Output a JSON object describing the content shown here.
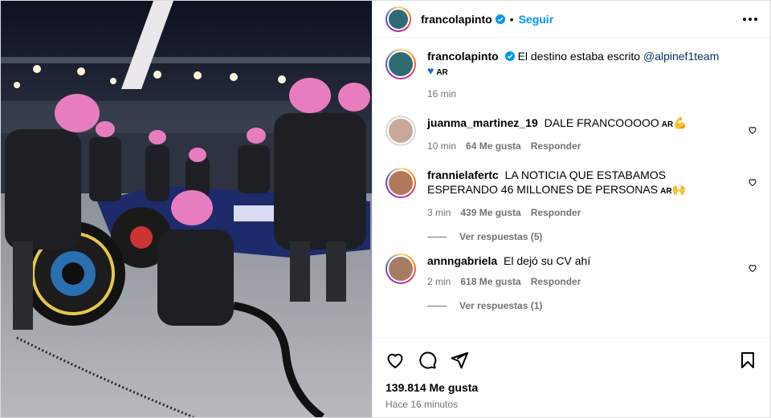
{
  "header": {
    "username": "francolapinto",
    "separator": "•",
    "follow_label": "Seguir"
  },
  "caption": {
    "username": "francolapinto",
    "text": "El destino estaba escrito",
    "mention": "@alpinef1team",
    "tag": "AR",
    "time": "16 min"
  },
  "comments": [
    {
      "username": "juanma_martinez_19",
      "text": "DALE FRANCOOOOO",
      "tag": "AR",
      "emoji": "💪",
      "time": "10 min",
      "likes": "64 Me gusta",
      "reply": "Responder"
    },
    {
      "username": "frannielafertc",
      "text": "LA NOTICIA QUE ESTABAMOS ESPERANDO 46 MILLONES DE PERSONAS",
      "tag": "AR",
      "emoji": "🙌",
      "time": "3 min",
      "likes": "439 Me gusta",
      "reply": "Responder",
      "view_replies": "Ver respuestas (5)"
    },
    {
      "username": "annngabriela",
      "text": "El dejó su CV ahí",
      "tag": "",
      "emoji": "",
      "time": "2 min",
      "likes": "618 Me gusta",
      "reply": "Responder",
      "view_replies": "Ver respuestas (1)"
    }
  ],
  "footer": {
    "likes": "139.814 Me gusta",
    "time": "Hace 16 minutos"
  },
  "colors": {
    "accent": "#0095f6",
    "mention": "#00376b",
    "muted": "#737373"
  }
}
